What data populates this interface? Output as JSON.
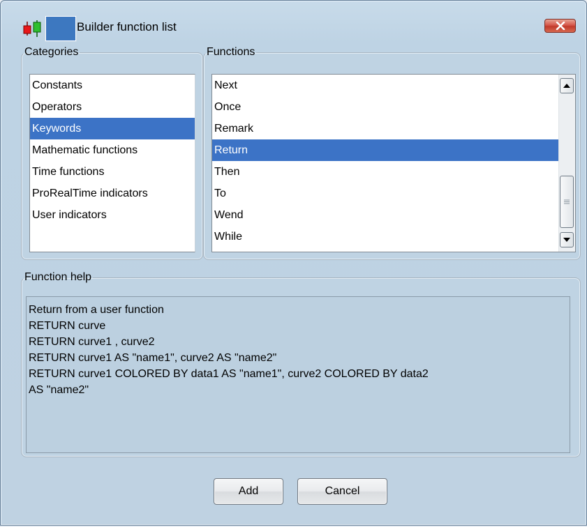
{
  "window": {
    "title": "Builder function list",
    "close_icon": "close-x-icon",
    "app_icon": "candlestick-chart-icon"
  },
  "categories": {
    "legend": "Categories",
    "items": [
      {
        "label": "Constants"
      },
      {
        "label": "Operators"
      },
      {
        "label": "Keywords",
        "selected": true
      },
      {
        "label": "Mathematic functions"
      },
      {
        "label": "Time functions"
      },
      {
        "label": "ProRealTime indicators"
      },
      {
        "label": "User indicators"
      }
    ]
  },
  "functions": {
    "legend": "Functions",
    "items": [
      {
        "label": "Next"
      },
      {
        "label": "Once"
      },
      {
        "label": "Remark"
      },
      {
        "label": "Return",
        "selected": true
      },
      {
        "label": "Then"
      },
      {
        "label": "To"
      },
      {
        "label": "Wend"
      },
      {
        "label": "While"
      }
    ]
  },
  "help": {
    "legend": "Function help",
    "lines": [
      "Return from a user function",
      "RETURN curve",
      "RETURN curve1 , curve2",
      "RETURN curve1 AS \"name1\", curve2 AS \"name2\"",
      "RETURN curve1 COLORED BY data1 AS \"name1\", curve2 COLORED BY data2",
      "AS \"name2\""
    ]
  },
  "buttons": {
    "add": "Add",
    "cancel": "Cancel"
  },
  "colors": {
    "selection": "#3c73c6",
    "dialog_background": "#bfd3e3",
    "close_button": "#c13a2a"
  }
}
